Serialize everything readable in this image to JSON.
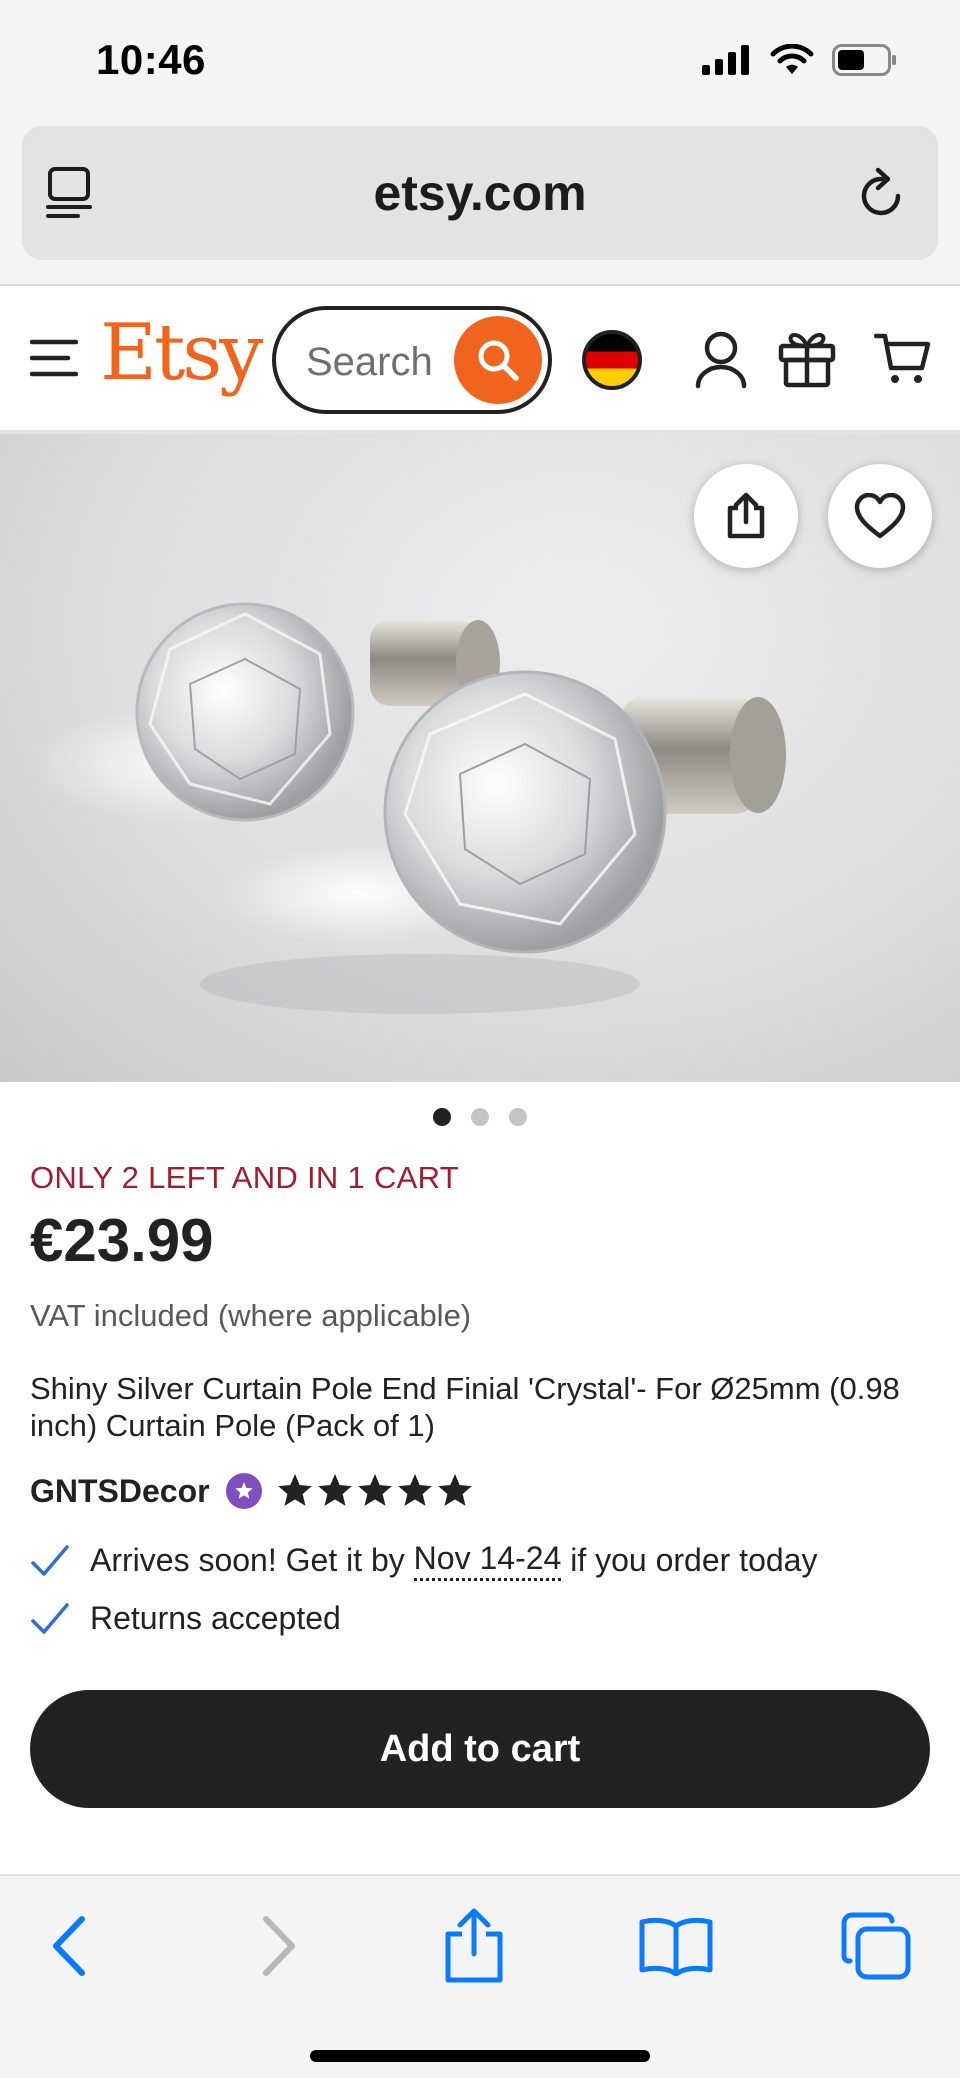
{
  "status_bar": {
    "time": "10:46",
    "battery_level": 0.55
  },
  "browser": {
    "url": "etsy.com"
  },
  "header": {
    "logo": "Etsy",
    "search_placeholder": "Search",
    "region_flag": "germany-flag"
  },
  "product": {
    "image_count": 3,
    "active_image": 1,
    "stock_note": "ONLY 2 LEFT AND IN 1 CART",
    "price": "€23.99",
    "vat_note": "VAT included (where applicable)",
    "title": "Shiny Silver Curtain Pole End Finial 'Crystal'- For Ø25mm (0.98 inch) Curtain Pole (Pack of 1)",
    "shop_name": "GNTSDecor",
    "rating": 5,
    "rating_max": 5,
    "delivery_prefix": "Arrives soon! Get it by",
    "delivery_dates": "Nov 14-24",
    "delivery_suffix": "if you order today",
    "returns": "Returns accepted",
    "add_to_cart_label": "Add to cart"
  },
  "colors": {
    "brand_orange": "#f1641e",
    "stock_red": "#a61a2e",
    "check_blue": "#2f6fd6",
    "safari_blue": "#0a7aff",
    "star_seller_purple": "#7f4fbf"
  }
}
